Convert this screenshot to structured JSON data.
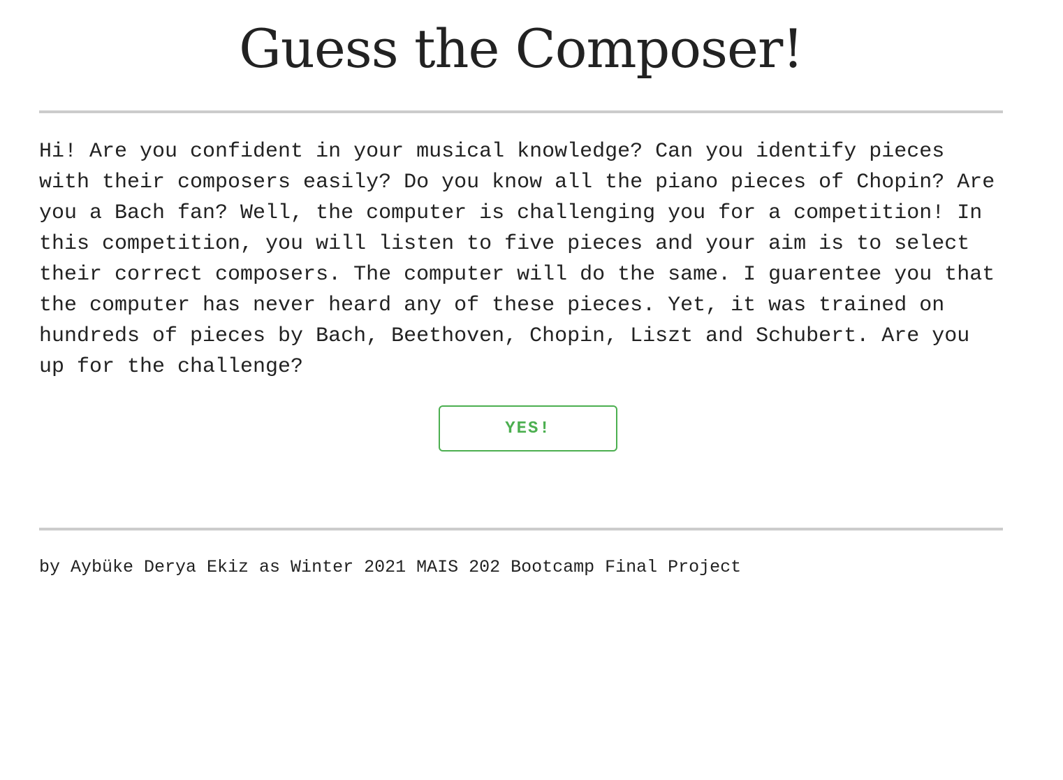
{
  "header": {
    "title": "Guess the Composer!"
  },
  "main": {
    "intro_text": "Hi! Are you confident in your musical knowledge? Can you identify pieces with their composers easily? Do you know all the piano pieces of Chopin? Are you a Bach fan? Well, the computer is challenging you for a competition! In this competition, you will listen to five pieces and your aim is to select their correct composers. The computer will do the same. I guarentee you that the computer has never heard any of these pieces. Yet, it was trained on hundreds of pieces by Bach, Beethoven, Chopin, Liszt and Schubert. Are you up for the challenge?",
    "start_button_label": "YES!"
  },
  "footer": {
    "credit": "by Aybüke Derya Ekiz as Winter 2021 MAIS 202 Bootcamp Final Project"
  },
  "colors": {
    "accent": "#4caf50",
    "text": "#222222",
    "divider": "#cccccc",
    "background": "#ffffff"
  }
}
